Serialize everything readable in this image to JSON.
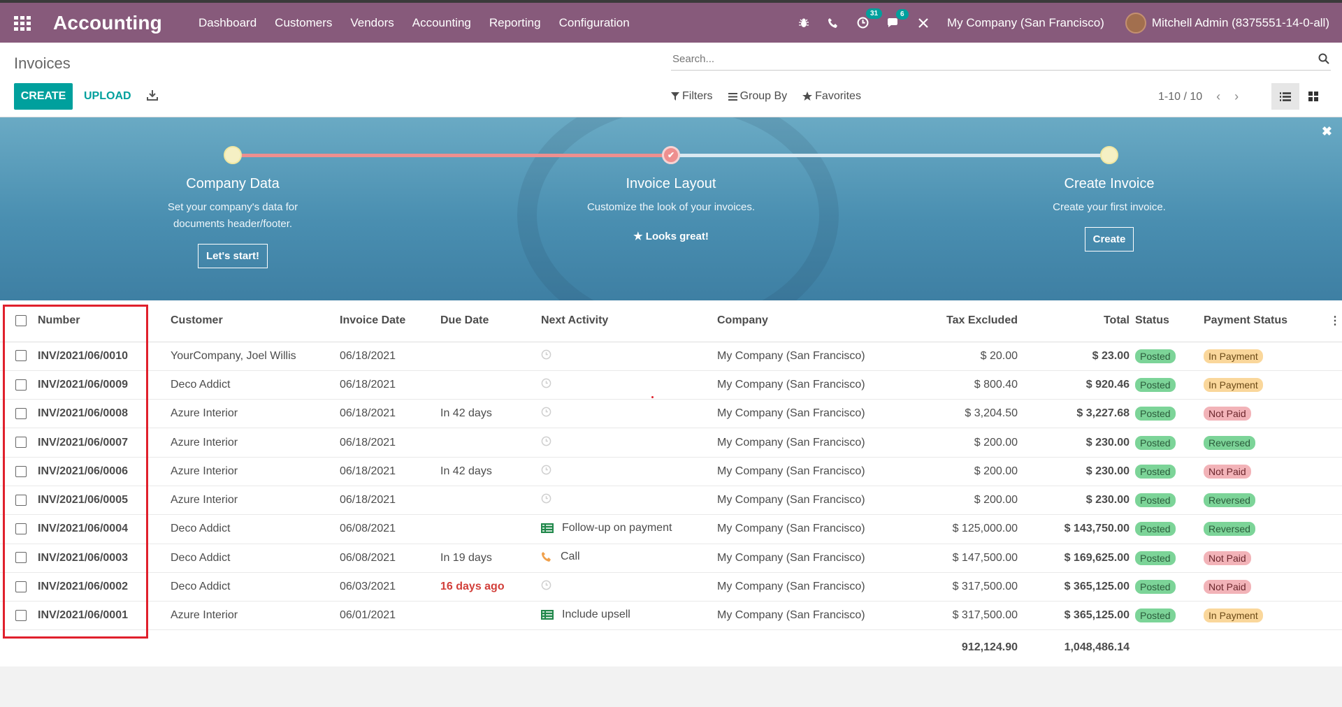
{
  "app": {
    "brand": "Accounting"
  },
  "menu": [
    "Dashboard",
    "Customers",
    "Vendors",
    "Accounting",
    "Reporting",
    "Configuration"
  ],
  "systray": {
    "activity_count": "31",
    "message_count": "6",
    "company": "My Company (San Francisco)",
    "user": "Mitchell Admin (8375551-14-0-all)"
  },
  "control_panel": {
    "breadcrumb": "Invoices",
    "search_placeholder": "Search...",
    "create_label": "CREATE",
    "upload_label": "UPLOAD",
    "filters_label": "Filters",
    "groupby_label": "Group By",
    "favorites_label": "Favorites",
    "pager": "1-10 / 10"
  },
  "onboarding": {
    "steps": [
      {
        "title": "Company Data",
        "desc1": "Set your company's data for",
        "desc2": "documents header/footer.",
        "button": "Let's start!"
      },
      {
        "title": "Invoice Layout",
        "desc1": "Customize the look of your invoices.",
        "done_text": "Looks great!"
      },
      {
        "title": "Create Invoice",
        "desc1": "Create your first invoice.",
        "button": "Create"
      }
    ]
  },
  "columns": [
    "Number",
    "Customer",
    "Invoice Date",
    "Due Date",
    "Next Activity",
    "Company",
    "Tax Excluded",
    "Total",
    "Status",
    "Payment Status"
  ],
  "rows": [
    {
      "number": "INV/2021/06/0010",
      "customer": "YourCompany, Joel Willis",
      "date": "06/18/2021",
      "due": "",
      "activity": "",
      "activity_icon": "clock-icon",
      "company": "My Company (San Francisco)",
      "tax": "$ 20.00",
      "total": "$ 23.00",
      "status": "Posted",
      "payment": "In Payment"
    },
    {
      "number": "INV/2021/06/0009",
      "customer": "Deco Addict",
      "date": "06/18/2021",
      "due": "",
      "activity": "",
      "activity_icon": "clock-icon",
      "company": "My Company (San Francisco)",
      "tax": "$ 800.40",
      "total": "$ 920.46",
      "status": "Posted",
      "payment": "In Payment"
    },
    {
      "number": "INV/2021/06/0008",
      "customer": "Azure Interior",
      "date": "06/18/2021",
      "due": "In 42 days",
      "activity": "",
      "activity_icon": "clock-icon",
      "company": "My Company (San Francisco)",
      "tax": "$ 3,204.50",
      "total": "$ 3,227.68",
      "status": "Posted",
      "payment": "Not Paid"
    },
    {
      "number": "INV/2021/06/0007",
      "customer": "Azure Interior",
      "date": "06/18/2021",
      "due": "",
      "activity": "",
      "activity_icon": "clock-icon",
      "company": "My Company (San Francisco)",
      "tax": "$ 200.00",
      "total": "$ 230.00",
      "status": "Posted",
      "payment": "Reversed"
    },
    {
      "number": "INV/2021/06/0006",
      "customer": "Azure Interior",
      "date": "06/18/2021",
      "due": "In 42 days",
      "activity": "",
      "activity_icon": "clock-icon",
      "company": "My Company (San Francisco)",
      "tax": "$ 200.00",
      "total": "$ 230.00",
      "status": "Posted",
      "payment": "Not Paid"
    },
    {
      "number": "INV/2021/06/0005",
      "customer": "Azure Interior",
      "date": "06/18/2021",
      "due": "",
      "activity": "",
      "activity_icon": "clock-icon",
      "company": "My Company (San Francisco)",
      "tax": "$ 200.00",
      "total": "$ 230.00",
      "status": "Posted",
      "payment": "Reversed"
    },
    {
      "number": "INV/2021/06/0004",
      "customer": "Deco Addict",
      "date": "06/08/2021",
      "due": "",
      "activity": "Follow-up on payment",
      "activity_icon": "list-icon",
      "company": "My Company (San Francisco)",
      "tax": "$ 125,000.00",
      "total": "$ 143,750.00",
      "status": "Posted",
      "payment": "Reversed"
    },
    {
      "number": "INV/2021/06/0003",
      "customer": "Deco Addict",
      "date": "06/08/2021",
      "due": "In 19 days",
      "activity": "Call",
      "activity_icon": "phone-icon",
      "company": "My Company (San Francisco)",
      "tax": "$ 147,500.00",
      "total": "$ 169,625.00",
      "status": "Posted",
      "payment": "Not Paid"
    },
    {
      "number": "INV/2021/06/0002",
      "customer": "Deco Addict",
      "date": "06/03/2021",
      "due": "16 days ago",
      "due_late": true,
      "activity": "",
      "activity_icon": "clock-icon",
      "company": "My Company (San Francisco)",
      "tax": "$ 317,500.00",
      "total": "$ 365,125.00",
      "status": "Posted",
      "payment": "Not Paid"
    },
    {
      "number": "INV/2021/06/0001",
      "customer": "Azure Interior",
      "date": "06/01/2021",
      "due": "",
      "activity": "Include upsell",
      "activity_icon": "list-icon",
      "company": "My Company (San Francisco)",
      "tax": "$ 317,500.00",
      "total": "$ 365,125.00",
      "status": "Posted",
      "payment": "In Payment"
    }
  ],
  "totals": {
    "tax": "912,124.90",
    "total": "1,048,486.14"
  },
  "colors": {
    "brand": "#875a7b",
    "primary": "#00a09d",
    "highlight": "#e0202c"
  }
}
